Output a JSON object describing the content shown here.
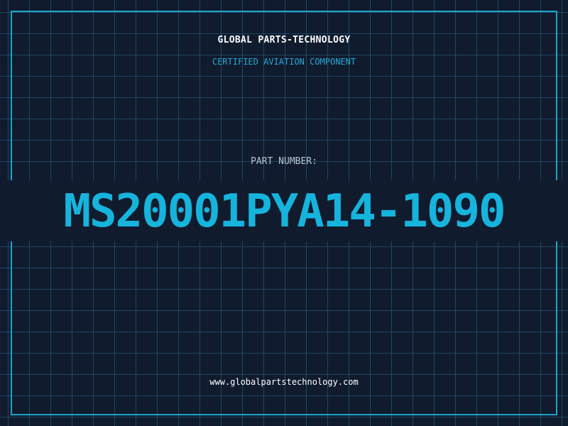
{
  "header": {
    "brand": "GLOBAL PARTS-TECHNOLOGY",
    "tagline": "CERTIFIED AVIATION COMPONENT"
  },
  "part": {
    "label": "PART NUMBER:",
    "number": "MS20001PYA14-1090"
  },
  "footer": {
    "website": "www.globalpartstechnology.com"
  },
  "colors": {
    "background": "#101b2e",
    "grid": "#286e8c",
    "accent": "#16b4dc",
    "border": "#1fa3c9",
    "text_primary": "#ffffff",
    "text_muted": "#b9c3cf"
  }
}
